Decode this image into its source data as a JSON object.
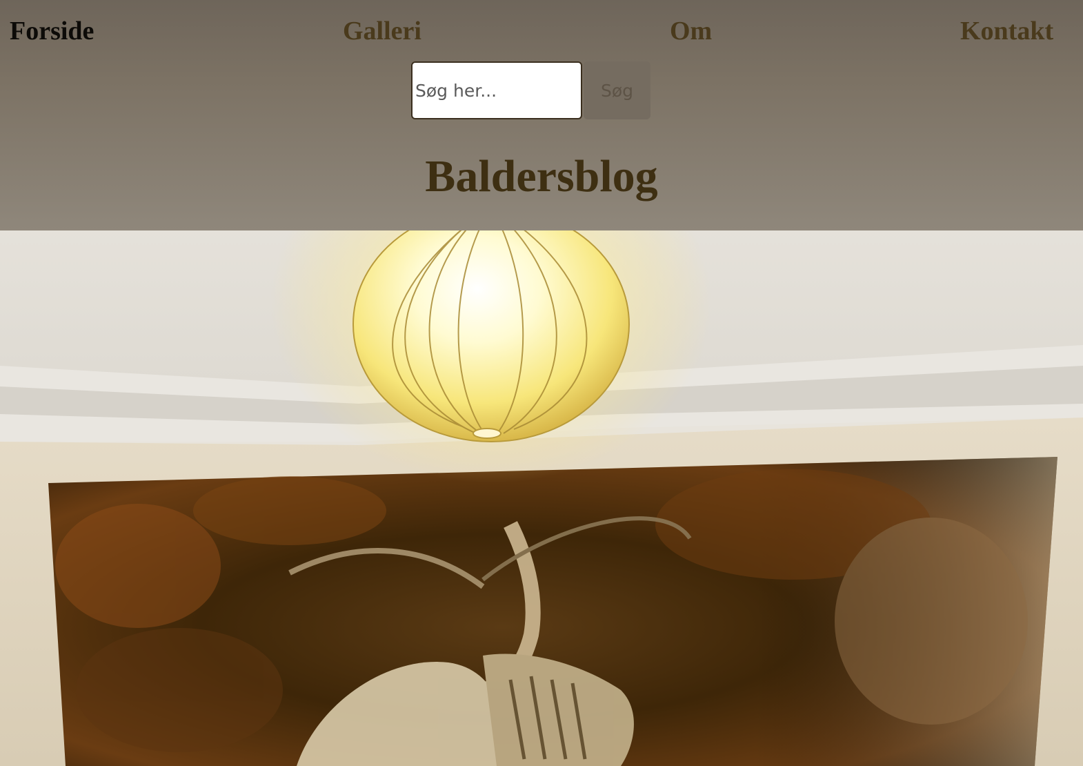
{
  "nav": {
    "items": [
      {
        "label": "Forside",
        "active": true
      },
      {
        "label": "Galleri",
        "active": false
      },
      {
        "label": "Om",
        "active": false
      },
      {
        "label": "Kontakt",
        "active": false
      }
    ]
  },
  "search": {
    "placeholder": "Søg her...",
    "value": "",
    "button_label": "Søg"
  },
  "site": {
    "title": "Baldersblog"
  },
  "colors": {
    "header_bg": "#7c7264",
    "title_color": "#3e2f12",
    "nav_active": "#0d0b08",
    "nav_inactive": "#4a3a1c"
  }
}
